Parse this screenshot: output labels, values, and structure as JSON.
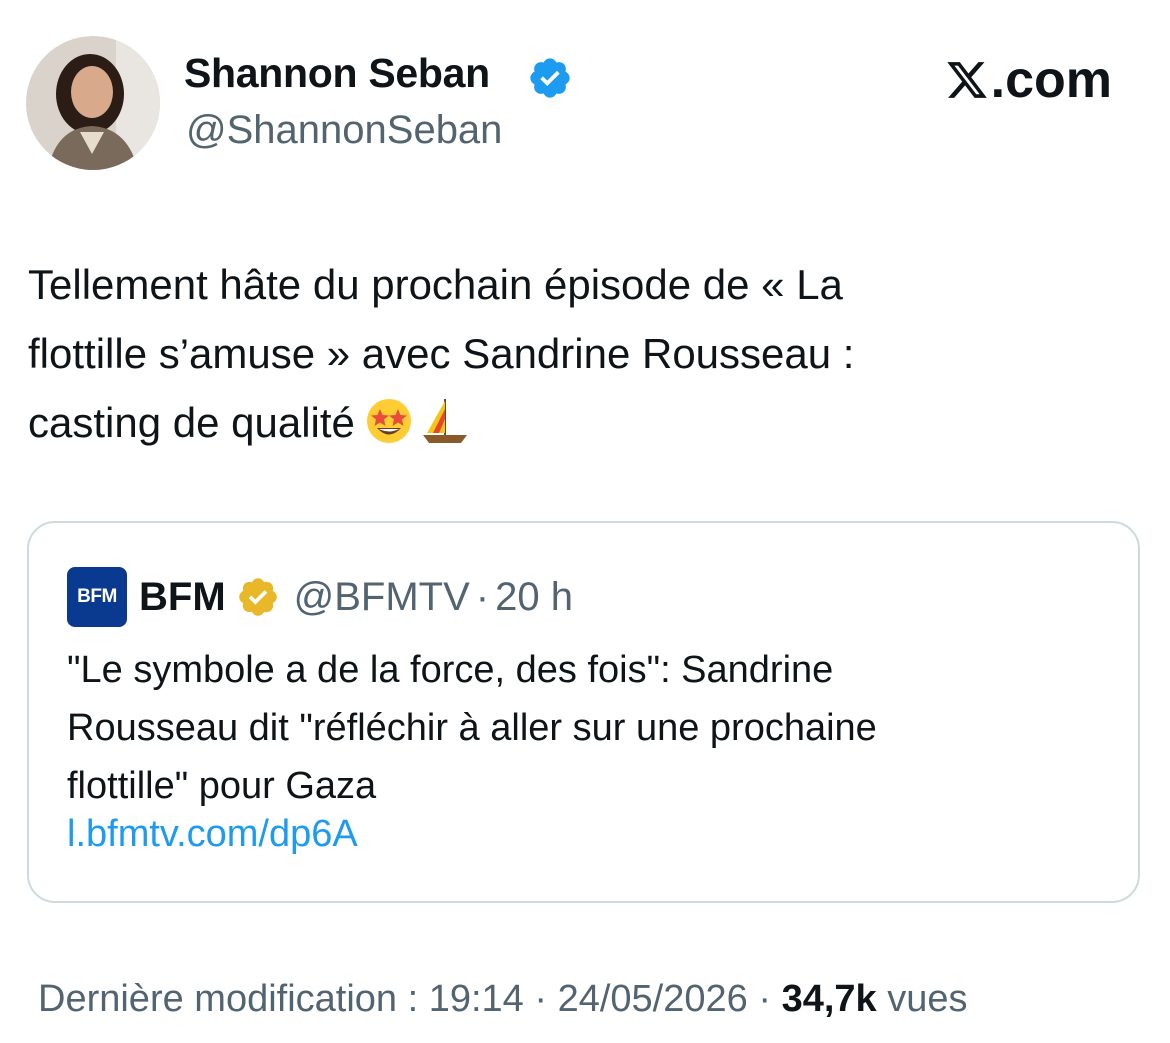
{
  "author": {
    "display_name": "Shannon Seban",
    "handle": "@ShannonSeban",
    "verified_color": "#1d9bf0",
    "avatar_icon": "avatar-photo"
  },
  "site": {
    "brand": ".com",
    "logo_icon": "x-logo-icon"
  },
  "tweet": {
    "text": "Tellement hâte du prochain épisode de « La\nflottille s’amuse » avec Sandrine Rousseau :\ncasting de qualité",
    "emojis": [
      "star-struck-emoji-icon",
      "sailboat-emoji-icon"
    ]
  },
  "quote": {
    "logo_text": "BFM",
    "name": "BFM",
    "badge_color": "#e8b829",
    "handle": "@BFMTV",
    "separator": "·",
    "time": "20 h",
    "text": "\"Le symbole a de la force, des fois\": Sandrine\nRousseau dit \"réfléchir à aller sur une prochaine\nflottille\" pour Gaza",
    "link": "l.bfmtv.com/dp6A",
    "link_color": "#1d9bf0"
  },
  "footer": {
    "edited_label": "Dernière modification : 19:14 · 24/05/2026",
    "separator": " · ",
    "views_count": "34,7k",
    "views_label": " vues"
  }
}
